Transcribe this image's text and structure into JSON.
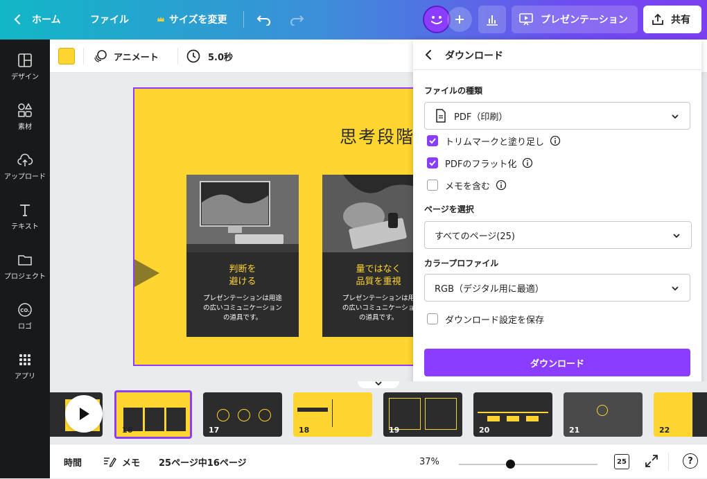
{
  "topbar": {
    "home_label": "ホーム",
    "file_label": "ファイル",
    "resize_label": "サイズを変更",
    "present_label": "プレゼンテーション",
    "share_label": "共有"
  },
  "sidebar": {
    "items": [
      {
        "label": "デザイン",
        "icon": "layout-icon"
      },
      {
        "label": "素材",
        "icon": "shapes-icon"
      },
      {
        "label": "アップロード",
        "icon": "cloud-upload-icon"
      },
      {
        "label": "テキスト",
        "icon": "text-icon"
      },
      {
        "label": "プロジェクト",
        "icon": "folder-icon"
      },
      {
        "label": "ロゴ",
        "icon": "logo-icon"
      },
      {
        "label": "アプリ",
        "icon": "apps-grid-icon"
      }
    ]
  },
  "toolbar": {
    "color_swatch": "#ffd530",
    "animate_label": "アニメート",
    "duration_label": "5.0秒"
  },
  "slide": {
    "title": "思考段階",
    "cards": [
      {
        "title_line1": "判断を",
        "title_line2": "避ける",
        "body_line1": "プレゼンテーションは用途",
        "body_line2": "の広いコミュニケーション",
        "body_line3": "の道具です。"
      },
      {
        "title_line1": "量ではなく",
        "title_line2": "品質を重視",
        "body_line1": "プレゼンテーションは用",
        "body_line2": "の広いコミュニケーショ",
        "body_line3": "の道具です。"
      }
    ]
  },
  "download_panel": {
    "header": "ダウンロード",
    "file_type_label": "ファイルの種類",
    "file_type_value": "PDF（印刷）",
    "options": [
      {
        "label": "トリムマークと塗り足し",
        "checked": true
      },
      {
        "label": "PDFのフラット化",
        "checked": true
      },
      {
        "label": "メモを含む",
        "checked": false
      }
    ],
    "pages_label": "ページを選択",
    "pages_value": "すべてのページ(25)",
    "color_profile_label": "カラープロファイル",
    "color_profile_value": "RGB（デジタル用に最適）",
    "save_settings_label": "ダウンロード設定を保存",
    "download_button": "ダウンロード"
  },
  "pages_strip": {
    "thumbs": [
      {
        "num": "16"
      },
      {
        "num": "17"
      },
      {
        "num": "18"
      },
      {
        "num": "19"
      },
      {
        "num": "20"
      },
      {
        "num": "21"
      },
      {
        "num": "22"
      }
    ]
  },
  "bottombar": {
    "timer_label": "時間",
    "notes_label": "メモ",
    "page_indicator": "25ページ中16ページ",
    "zoom_value": "37%",
    "zoom_fraction": 0.37,
    "page_count_badge": "25",
    "help_label": "?"
  },
  "colors": {
    "accent": "#8b3dff",
    "slide_yellow": "#ffd530",
    "sidebar_bg": "#18191b"
  }
}
